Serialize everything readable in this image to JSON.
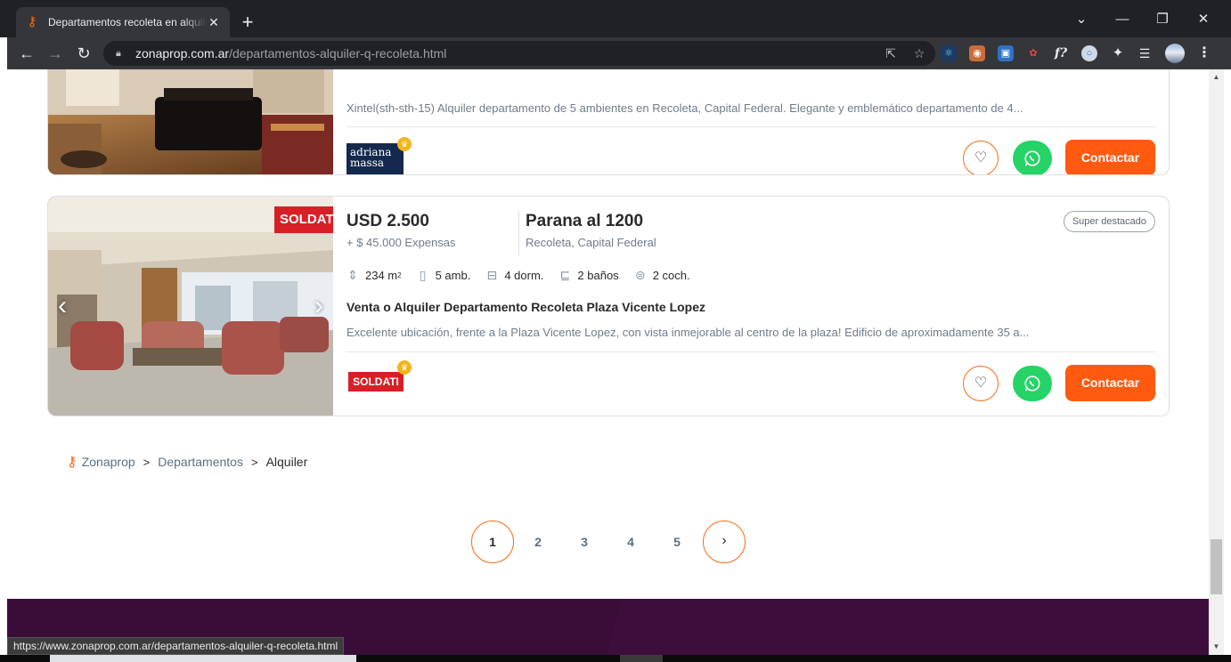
{
  "browser": {
    "tab_title": "Departamentos recoleta en alquiler",
    "tab_close": "✕",
    "new_tab": "+",
    "window": {
      "chevron": "⌄",
      "minimize": "—",
      "restore": "❐",
      "close": "✕"
    },
    "nav": {
      "back": "←",
      "forward": "→",
      "reload": "↻"
    },
    "url_host": "zonaprop.com.ar",
    "url_path": "/departamentos-alquiler-q-recoleta.html",
    "extensions": [
      "react-devtools",
      "owl",
      "picture-in-picture",
      "color-picker",
      "font-inspector",
      "circle-ext",
      "puzzle",
      "reading-list"
    ]
  },
  "listings": [
    {
      "description": "Xintel(sth-sth-15) Alquiler departamento de 5 ambientes en Recoleta, Capital Federal. Elegante y emblemático departamento de 4...",
      "publisher_logo": "adriana massa",
      "contact_label": "Contactar"
    },
    {
      "price": "USD 2.500",
      "expensas": "+ $ 45.000 Expensas",
      "address": "Parana al 1200",
      "location": "Recoleta, Capital Federal",
      "badge": "Super destacado",
      "features": {
        "area_value": "234 m",
        "area_sup": "2",
        "ambientes": "5 amb.",
        "dormitorios": "4 dorm.",
        "banos": "2 baños",
        "cocheras": "2 coch."
      },
      "title": "Venta o Alquiler Departamento Recoleta Plaza Vicente Lopez",
      "description": "Excelente ubicación, frente a la Plaza Vicente Lopez, con vista inmejorable al centro de la plaza! Edificio de aproximadamente 35 a...",
      "image_logo": "SOLDATI",
      "publisher_logo": "SOLDATI",
      "contact_label": "Contactar"
    }
  ],
  "breadcrumb": {
    "items": [
      "Zonaprop",
      "Departamentos"
    ],
    "current": "Alquiler",
    "separator": ">"
  },
  "pagination": {
    "pages": [
      "1",
      "2",
      "3",
      "4",
      "5"
    ],
    "active": "1",
    "next": "›"
  },
  "status_bar": "https://www.zonaprop.com.ar/departamentos-alquiler-q-recoleta.html",
  "colors": {
    "brand_orange": "#ff5a10",
    "whatsapp_green": "#25d366",
    "footer_purple": "#3d0e3c"
  }
}
